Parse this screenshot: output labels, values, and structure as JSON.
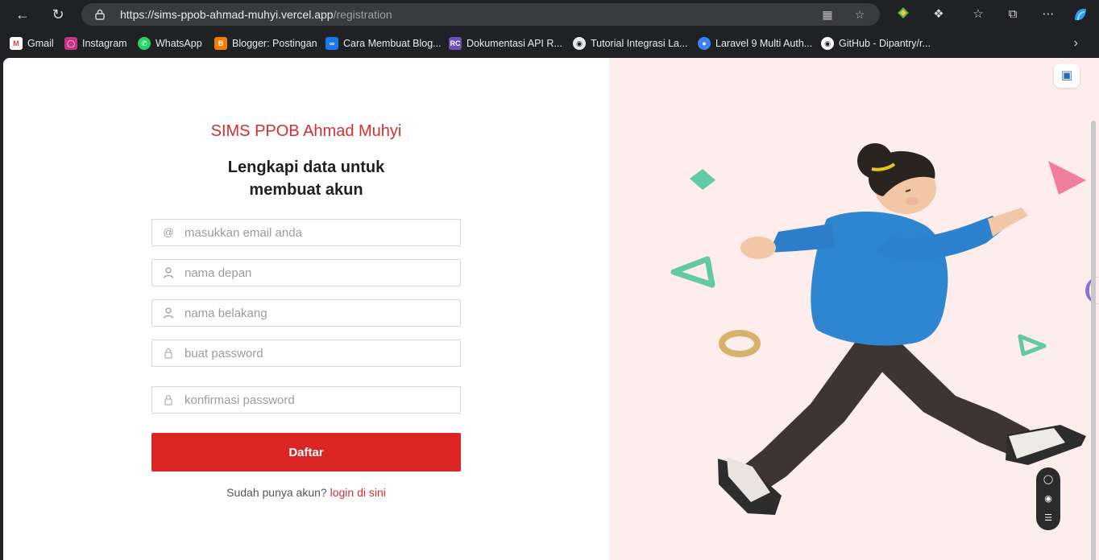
{
  "browser": {
    "url_host": "https://sims-ppob-ahmad-muhyi.vercel.app",
    "url_path": "/registration",
    "bookmarks": [
      {
        "label": "Gmail",
        "color": "#ea4335"
      },
      {
        "label": "Instagram",
        "color": "#c13584"
      },
      {
        "label": "WhatsApp",
        "color": "#25d366"
      },
      {
        "label": "Blogger: Postingan",
        "color": "#f57d00"
      },
      {
        "label": "Cara Membuat Blog...",
        "color": "#1877f2"
      },
      {
        "label": "Dokumentasi API R...",
        "color": "#6b4fbb"
      },
      {
        "label": "Tutorial Integrasi La...",
        "color": "#e8eaed"
      },
      {
        "label": "Laravel 9 Multi Auth...",
        "color": "#3b82f6"
      },
      {
        "label": "GitHub - Dipantry/r...",
        "color": "#ffffff"
      }
    ]
  },
  "form": {
    "brand": "SIMS PPOB Ahmad Muhyi",
    "heading_line1": "Lengkapi data untuk",
    "heading_line2": "membuat akun",
    "email_placeholder": "masukkan email anda",
    "first_name_placeholder": "nama depan",
    "last_name_placeholder": "nama belakang",
    "password_placeholder": "buat password",
    "confirm_placeholder": "konfirmasi password",
    "submit_label": "Daftar",
    "footer_text": "Sudah punya akun?",
    "login_link": "login di sini"
  },
  "colors": {
    "accent": "#dc2626",
    "brand_text": "#d32f2f",
    "illustration_bg": "#fdeeed"
  }
}
